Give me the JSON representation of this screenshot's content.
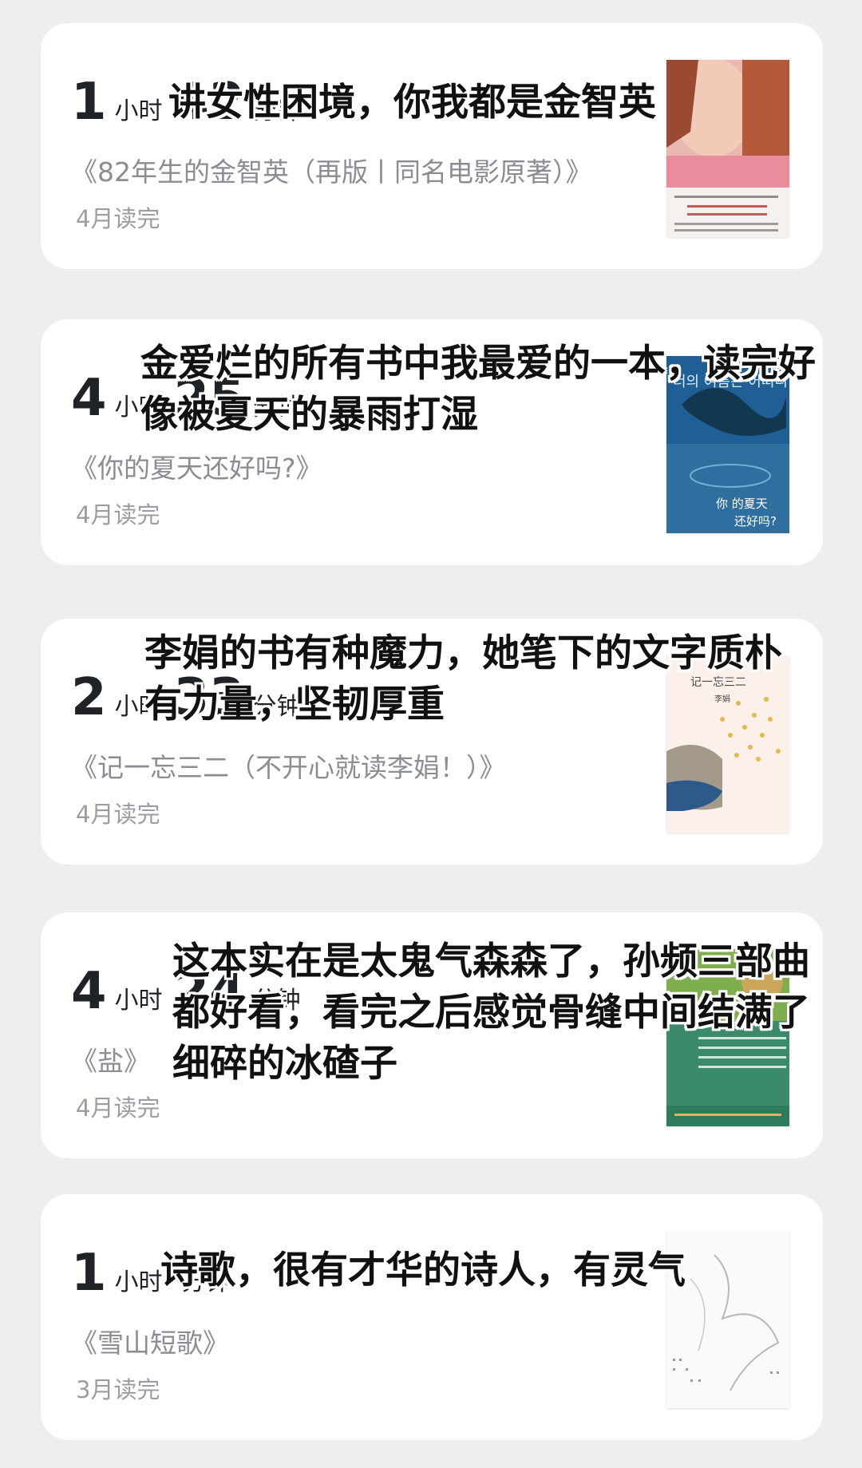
{
  "books": [
    {
      "hours": "1",
      "hours_unit": "小时",
      "minutes": "42",
      "minutes_unit": "分钟",
      "title": "《82年生的金智英（再版丨同名电影原著）》",
      "finished": "4月读完",
      "comment": "讲女性困境，你我都是金智英"
    },
    {
      "hours": "4",
      "hours_unit": "小时",
      "minutes": "25",
      "minutes_unit": "分钟",
      "title": "《你的夏天还好吗?》",
      "finished": "4月读完",
      "comment": "金爱烂的所有书中我最爱的一本，读完好像被夏天的暴雨打湿",
      "cover_text": [
        "너의 여름은 어떠니",
        "你  的夏天",
        "还好吗?"
      ]
    },
    {
      "hours": "2",
      "hours_unit": "小时",
      "minutes": "33",
      "minutes_unit": "分钟",
      "title": "《记一忘三二（不开心就读李娟！）》",
      "finished": "4月读完",
      "comment": "李娟的书有种魔力，她笔下的文字质朴有力量，坚韧厚重",
      "cover_text": [
        "记一忘三二",
        "李娟"
      ]
    },
    {
      "hours": "4",
      "hours_unit": "小时",
      "minutes": "24",
      "minutes_unit": "分钟",
      "title": "《盐》",
      "finished": "4月读完",
      "comment": "这本实在是太鬼气森森了，孙频三部曲都好看，看完之后感觉骨缝中间结满了细碎的冰碴子"
    },
    {
      "hours": "1",
      "hours_unit": "小时",
      "minutes": "",
      "minutes_unit": "分钟",
      "title": "《雪山短歌》",
      "finished": "3月读完",
      "comment": "诗歌，很有才华的诗人，有灵气"
    }
  ]
}
